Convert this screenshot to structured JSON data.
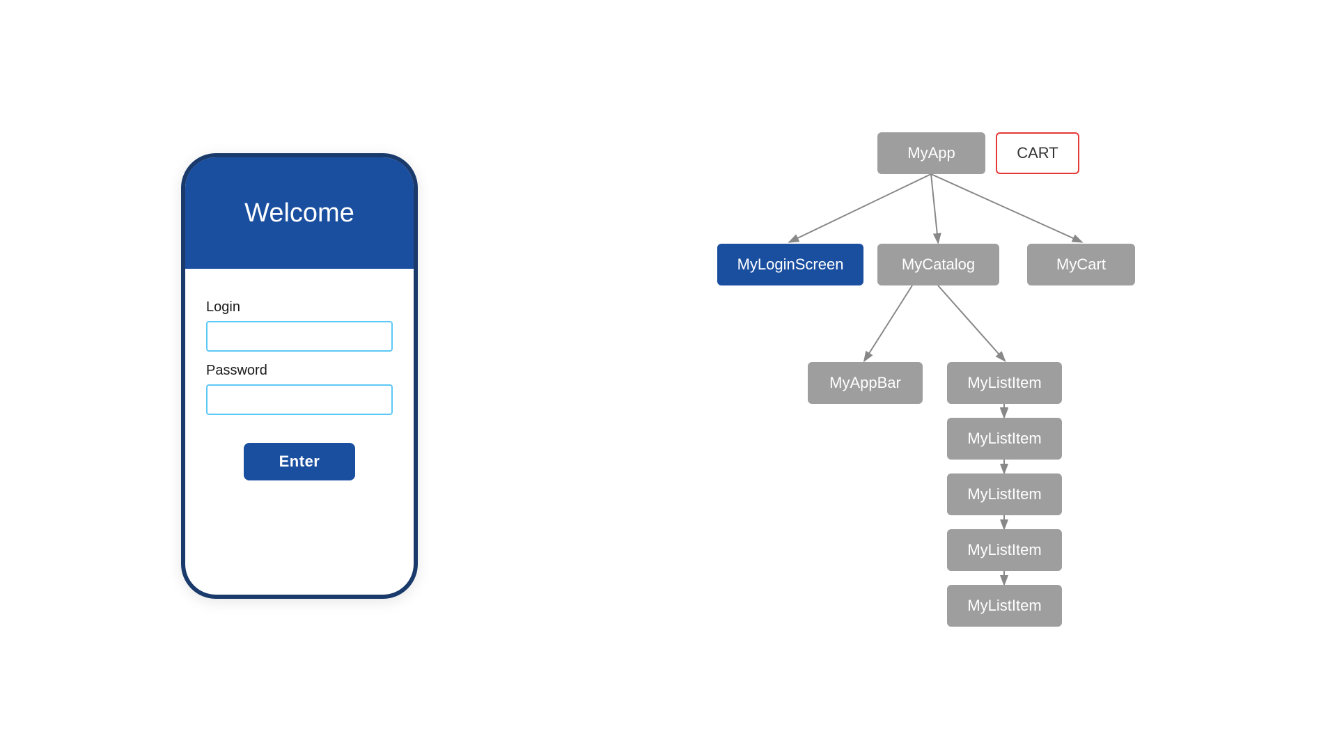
{
  "phone": {
    "header_title": "Welcome",
    "login_label": "Login",
    "login_placeholder": "",
    "password_label": "Password",
    "password_placeholder": "",
    "enter_button": "Enter"
  },
  "tree": {
    "nodes": {
      "myapp": "MyApp",
      "cart": "CART",
      "login_screen": "MyLoginScreen",
      "catalog": "MyCatalog",
      "my_cart": "MyCart",
      "app_bar": "MyAppBar",
      "list_item_1": "MyListItem",
      "list_item_2": "MyListItem",
      "list_item_3": "MyListItem",
      "list_item_4": "MyListItem",
      "list_item_5": "MyListItem"
    }
  }
}
